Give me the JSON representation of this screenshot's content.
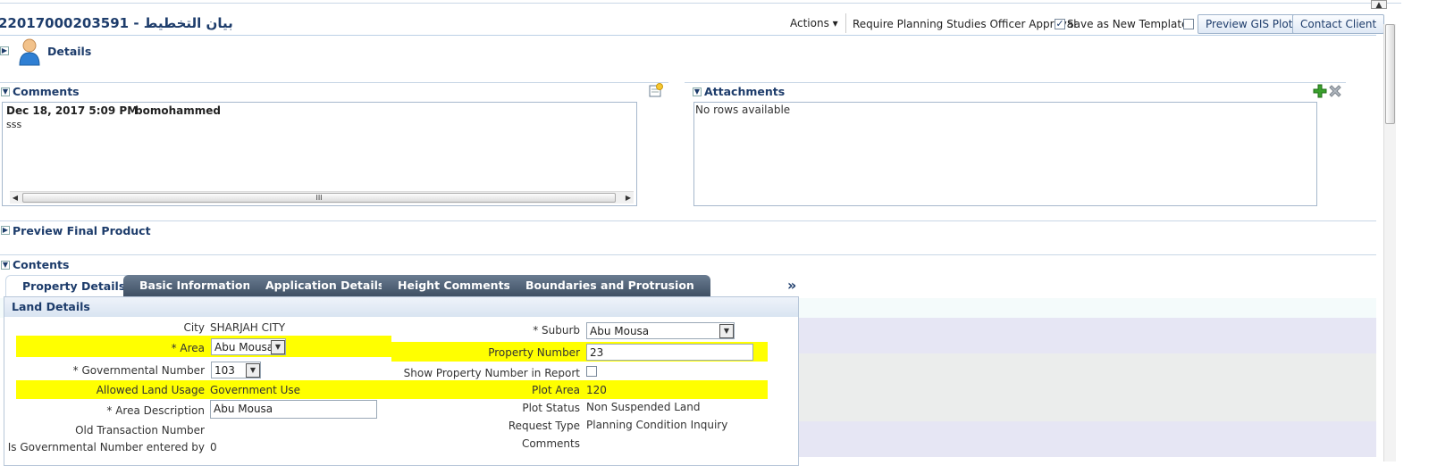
{
  "header": {
    "title": "22017000203591 - بيان التخطيط",
    "actions_label": "Actions ▾",
    "require_label": "Require Planning Studies Officer Approval",
    "save_template_label": "Save as New Template",
    "preview_gis_label": "Preview GIS Plot",
    "contact_client_label": "Contact Client"
  },
  "details": {
    "label": "Details"
  },
  "comments": {
    "title": "Comments",
    "entry": {
      "date": "Dec 18, 2017 5:09 PM",
      "user": "bomohammed",
      "text": "sss"
    },
    "scroll_grip": "III"
  },
  "attachments": {
    "title": "Attachments",
    "empty_text": "No rows available"
  },
  "preview_final": {
    "title": "Preview Final Product"
  },
  "contents": {
    "title": "Contents",
    "tabs": [
      {
        "label": "Property Details"
      },
      {
        "label": "Basic Information"
      },
      {
        "label": "Application Details"
      },
      {
        "label": "Height Comments"
      },
      {
        "label": "Boundaries and Protrusion"
      }
    ],
    "more_label": "»"
  },
  "land": {
    "title": "Land Details",
    "city_label": "City",
    "city_value": "SHARJAH CITY",
    "area_label": "* Area",
    "area_value": "Abu Mousa",
    "gov_label": "* Governmental Number",
    "gov_value": "103",
    "usage_label": "Allowed Land Usage",
    "usage_value": "Government Use",
    "area_desc_label": "* Area Description",
    "area_desc_value": "Abu Mousa",
    "old_tx_label": "Old Transaction Number",
    "gov_entered_label": "Is Governmental Number entered by",
    "gov_entered_value": "0",
    "suburb_label": "* Suburb",
    "suburb_value": "Abu Mousa",
    "prop_num_label": "Property Number",
    "prop_num_value": "23",
    "show_prop_label": "Show Property Number in Report",
    "plot_area_label": "Plot Area",
    "plot_area_value": "120",
    "plot_status_label": "Plot Status",
    "plot_status_value": "Non Suspended Land",
    "request_type_label": "Request Type",
    "request_type_value": "Planning Condition Inquiry",
    "comments_label": "Comments"
  },
  "colors": {
    "highlight": "#ffff00",
    "title": "#1d3c6b",
    "tab_dark": "#4a5b70"
  },
  "icons": [
    "user-icon",
    "add-comment-icon",
    "add-icon",
    "delete-icon",
    "disclosure-icon",
    "dropdown-icon"
  ]
}
